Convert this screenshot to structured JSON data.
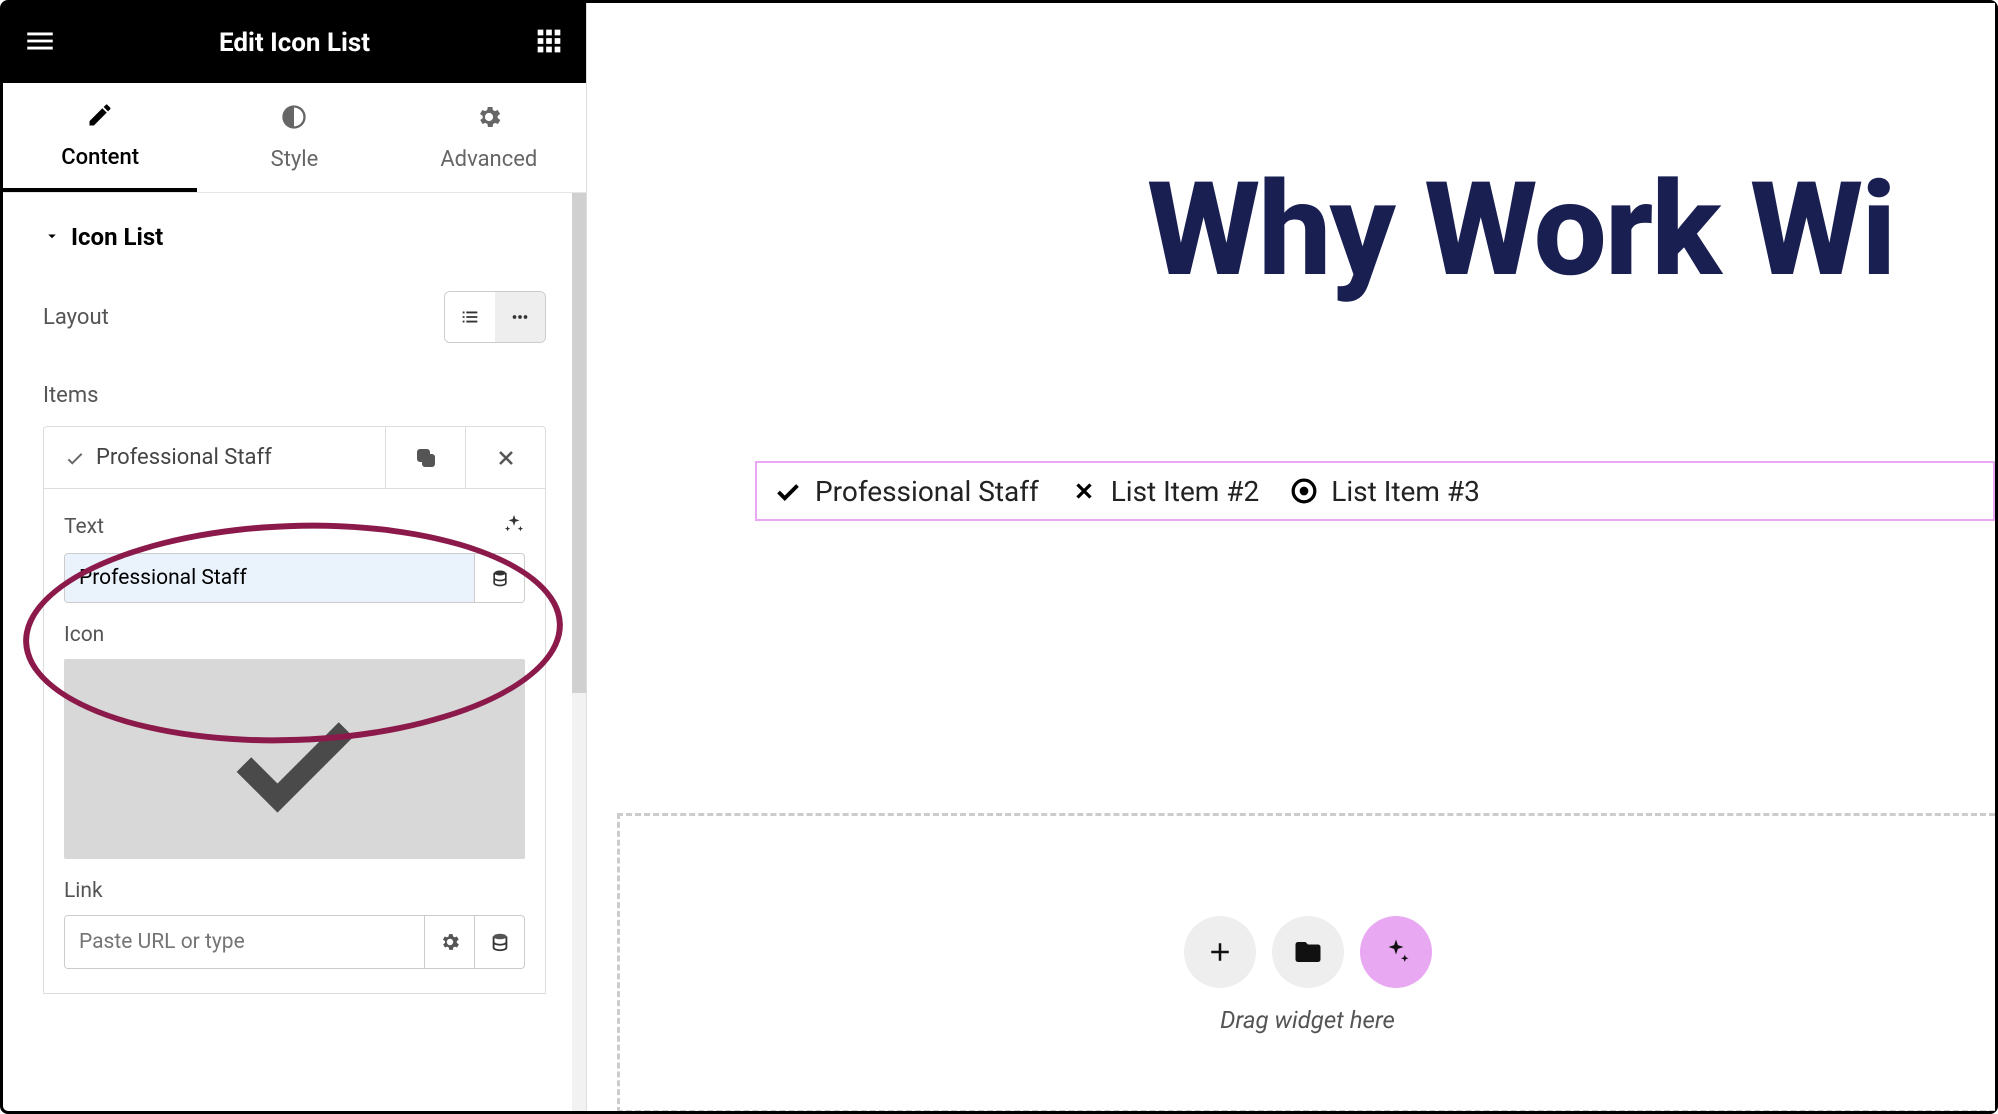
{
  "header": {
    "title": "Edit Icon List"
  },
  "tabs": {
    "content": "Content",
    "style": "Style",
    "advanced": "Advanced"
  },
  "section": {
    "title": "Icon List"
  },
  "layout": {
    "label": "Layout"
  },
  "items": {
    "label": "Items"
  },
  "item": {
    "title": "Professional Staff",
    "text_label": "Text",
    "text_value": "Professional Staff",
    "icon_label": "Icon",
    "link_label": "Link",
    "link_placeholder": "Paste URL or type"
  },
  "canvas": {
    "heading": "Why Work Wi",
    "list": {
      "a": "Professional Staff",
      "b": "List Item #2",
      "c": "List Item #3"
    },
    "drop_hint": "Drag widget here"
  }
}
